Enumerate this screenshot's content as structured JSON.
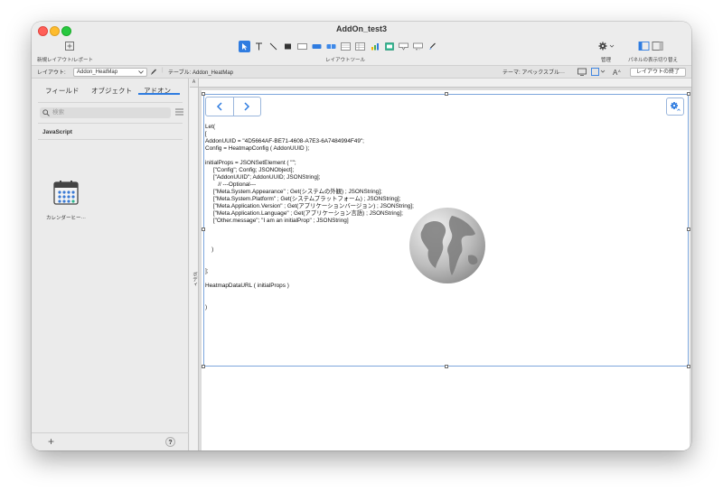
{
  "window": {
    "title": "AddOn_test3"
  },
  "toolbar": {
    "new_layout_label": "新規レイアウト/レポート",
    "layout_tools_label": "レイアウトツール",
    "manage_label": "管理",
    "panel_toggle_label": "パネルの表示切り替え"
  },
  "layoutbar": {
    "layout_prefix": "レイアウト:",
    "layout_value": "Addon_HeatMap",
    "table_text": "テーブル: Addon_HeatMap",
    "theme_text": "テーマ: アペックスブル···",
    "exit_label": "レイアウトの終了"
  },
  "sidebar": {
    "tabs": [
      "フィールド",
      "オブジェクト",
      "アドオン"
    ],
    "active_tab": "アドオン",
    "search_placeholder": "検索",
    "section": "JavaScript",
    "addon_item": "カレンダーヒー···"
  },
  "canvas": {
    "corner_label": "A",
    "body_label": "ボディ",
    "code_lines": [
      "Let(",
      "[",
      "AddonUUID = \"4D5664AF-BE71-4608-A7E3-6A7484994F49\";",
      "Config = HeatmapConfig ( AddonUUID );",
      "",
      "initialProps = JSONSetElement ( \"\";",
      "     [\"Config\"; Config; JSONObject];",
      "     [\"AddonUUID\"; AddonUUID; JSONString];",
      "        // ---Optional---",
      "     [\"Meta.System.Appearance\" ; Get(システムの外観) ; JSONString];",
      "     [\"Meta.System.Platform\" ; Get(システムプラットフォーム) ; JSONString];",
      "     [\"Meta.Application.Version\" ; Get(アプリケーションバージョン) ; JSONString];",
      "     [\"Meta.Application.Language\" ; Get(アプリケーション言語) ; JSONString];",
      "     [\"Other.message\"; \"I am an initialProp\" ; JSONString]",
      "",
      "",
      "",
      "    )",
      "",
      "",
      "];",
      "",
      "HeatmapDataURL ( initialProps )",
      "",
      "",
      ")"
    ]
  },
  "colors": {
    "accent": "#2f7ce0",
    "selection_border": "#7da6dc"
  }
}
